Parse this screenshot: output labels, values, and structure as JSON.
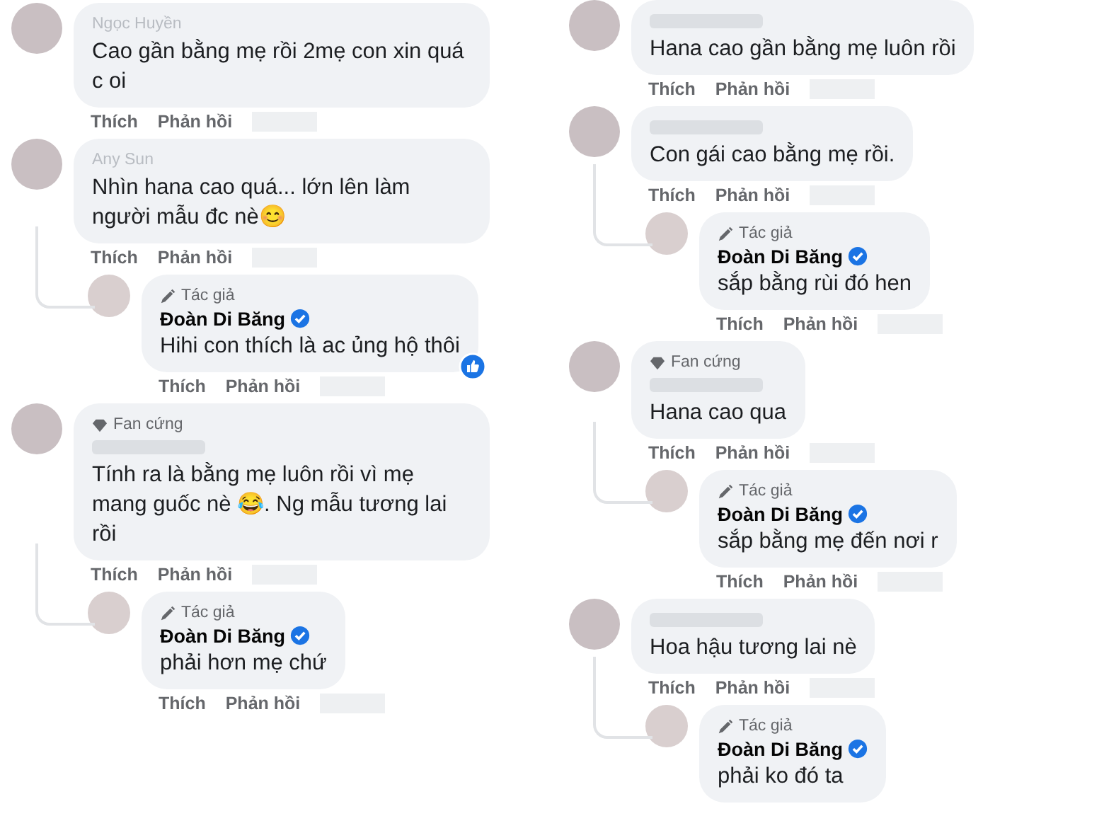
{
  "columns": [
    {
      "comments": [
        {
          "kind": "comment",
          "name": "Ngọc Huyền",
          "name_blurred": true,
          "text": "Cao gần bằng mẹ rồi 2mẹ con xin quá c oi",
          "actions": [
            "Thích",
            "Phản hồi"
          ]
        },
        {
          "kind": "comment",
          "name": "Any Sun",
          "name_blurred": true,
          "text": "Nhìn hana cao quá... lớn lên làm người mẫu đc nè😊",
          "actions": [
            "Thích",
            "Phản hồi"
          ]
        },
        {
          "kind": "reply",
          "badge": {
            "kind": "author",
            "label": "Tác giả"
          },
          "name": "Đoàn Di Băng",
          "verified": true,
          "text": "Hihi con thích là ac ủng hộ thôi",
          "liked": true,
          "actions": [
            "Thích",
            "Phản hồi"
          ]
        },
        {
          "kind": "comment",
          "badge": {
            "kind": "fan",
            "label": "Fan cứng"
          },
          "text": "Tính ra là bằng mẹ luôn rồi vì mẹ mang guốc nè 😂. Ng mẫu tương lai rồi",
          "actions": [
            "Thích",
            "Phản hồi"
          ]
        },
        {
          "kind": "reply",
          "badge": {
            "kind": "author",
            "label": "Tác giả"
          },
          "name": "Đoàn Di Băng",
          "verified": true,
          "text": "phải hơn mẹ chứ",
          "actions": [
            "Thích",
            "Phản hồi"
          ]
        }
      ]
    },
    {
      "comments": [
        {
          "kind": "comment",
          "text": "Hana cao gần bằng mẹ luôn rồi",
          "actions": [
            "Thích",
            "Phản hồi"
          ]
        },
        {
          "kind": "comment",
          "text": "Con gái cao bằng mẹ rồi.",
          "actions": [
            "Thích",
            "Phản hồi"
          ]
        },
        {
          "kind": "reply",
          "badge": {
            "kind": "author",
            "label": "Tác giả"
          },
          "name": "Đoàn Di Băng",
          "verified": true,
          "text": "sắp bằng rùi đó hen",
          "actions": [
            "Thích",
            "Phản hồi"
          ]
        },
        {
          "kind": "comment",
          "badge": {
            "kind": "fan",
            "label": "Fan cứng"
          },
          "text": "Hana cao qua",
          "actions": [
            "Thích",
            "Phản hồi"
          ]
        },
        {
          "kind": "reply",
          "badge": {
            "kind": "author",
            "label": "Tác giả"
          },
          "name": "Đoàn Di Băng",
          "verified": true,
          "text": "sắp bằng mẹ đến nơi r",
          "actions": [
            "Thích",
            "Phản hồi"
          ]
        },
        {
          "kind": "comment",
          "text": "Hoa hậu tương lai nè",
          "actions": [
            "Thích",
            "Phản hồi"
          ]
        },
        {
          "kind": "reply",
          "badge": {
            "kind": "author",
            "label": "Tác giả"
          },
          "name": "Đoàn Di Băng",
          "verified": true,
          "text": "phải ko đó ta"
        }
      ]
    }
  ]
}
